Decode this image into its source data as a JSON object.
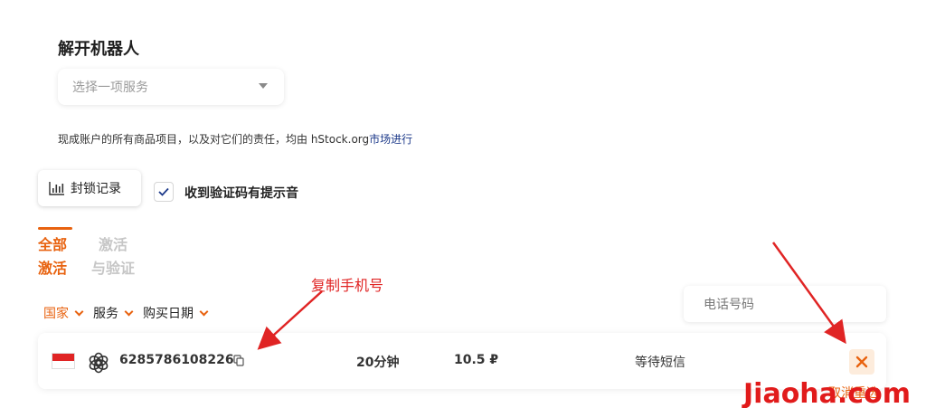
{
  "page": {
    "title": "解开机器人",
    "service_select_placeholder": "选择一项服务",
    "notice_prefix": "现成账户的所有商品项目，以及对它们的责任，均由 hStock.org",
    "notice_link": "市场进行"
  },
  "toolbar": {
    "lock_history_label": "封锁记录",
    "sound_checkbox_label": "收到验证码有提示音",
    "sound_checked": true
  },
  "tabs": [
    {
      "line1": "全部",
      "line2": "激活",
      "active": true
    },
    {
      "line1": "激活",
      "line2": "与验证",
      "active": false
    }
  ],
  "filters": [
    {
      "label": "国家",
      "active": true
    },
    {
      "label": "服务",
      "active": false
    },
    {
      "label": "购买日期",
      "active": true
    }
  ],
  "phone_search": {
    "placeholder": "电话号码"
  },
  "row": {
    "country_flag": "Indonesia",
    "service_icon": "openai-icon",
    "phone": "6285786108226",
    "duration": "20分钟",
    "price": "10.5 ₽",
    "status": "等待短信"
  },
  "cancel_caption": "取消重选",
  "annotation": "复制手机号",
  "watermark": "Jiaoha.com",
  "colors": {
    "accent": "#e8620f",
    "annotation": "#e02424",
    "link": "#1d3a8a"
  }
}
